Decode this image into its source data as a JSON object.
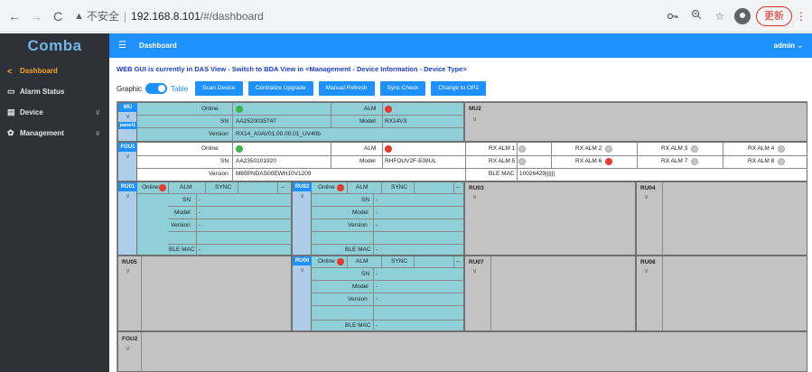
{
  "browser": {
    "back": "←",
    "forward": "→",
    "reload": "C",
    "warn_icon": "▲",
    "insecure": "不安全",
    "host": "192.168.8.101",
    "path": "/#/dashboard",
    "update": "更新",
    "kebab": "⋮",
    "key_icon": "key-icon",
    "zoom_icon": "zoom-icon",
    "star_icon": "star-icon",
    "profile_icon": "profile-icon"
  },
  "sidebar": {
    "logo": "Comba",
    "items": [
      {
        "label": "Dashboard",
        "icon": "share-icon",
        "active": true
      },
      {
        "label": "Alarm Status",
        "icon": "monitor-icon"
      },
      {
        "label": "Device",
        "icon": "list-icon",
        "chevron": "∨"
      },
      {
        "label": "Management",
        "icon": "gear-icon",
        "chevron": "∨"
      }
    ]
  },
  "topbar": {
    "title": "Dashboard",
    "menu_icon": "menu-icon",
    "user": "admin"
  },
  "notice": "WEB GUI is currently in DAS View - Switch to BDA View in <Management - Device Information - Device Type>",
  "toolbar": {
    "graphic": "Graphic",
    "table": "Table",
    "buttons": [
      "Scan Device",
      "Centralize Upgrade",
      "Manual Refresh",
      "Sync Check",
      "Change to OP2"
    ]
  },
  "mu": {
    "tag": "MU",
    "panel": "panel1",
    "online": "Online",
    "alm": "ALM",
    "sn_label": "SN",
    "sn": "AA2520035747",
    "model_label": "Model",
    "model": "RX14V3",
    "version_label": "Version",
    "version": "RX14_A0AV01.00.00.01_UV40b"
  },
  "mu2": {
    "tag": "MU2"
  },
  "fou1": {
    "tag": "FOU1",
    "online": "Online",
    "alm": "ALM",
    "sn_label": "SN",
    "sn": "AA2350101920",
    "model_label": "Model",
    "model": "RHFOUV2F-E08UL",
    "version_label": "Version",
    "version": "M65PNDAS00EWH10V1209",
    "rx": [
      "RX ALM 1",
      "RX ALM 2",
      "RX ALM 3",
      "RX ALM 4",
      "RX ALM 5",
      "RX ALM 6",
      "RX ALM 7",
      "RX ALM 8"
    ],
    "ble_label": "BLE MAC",
    "ble": "10026429||||||"
  },
  "ru": {
    "online": "Online",
    "alm": "ALM",
    "sync": "SYNC",
    "dash": "--",
    "sn": "SN",
    "model": "Model",
    "version": "Version",
    "ble": "BLE MAC",
    "val": "-",
    "tags": [
      "RU01",
      "RU02",
      "RU03",
      "RU04",
      "RU05",
      "RU06",
      "RU07",
      "RU08"
    ]
  },
  "fou2": {
    "tag": "FOU2"
  },
  "chevron": "∨"
}
